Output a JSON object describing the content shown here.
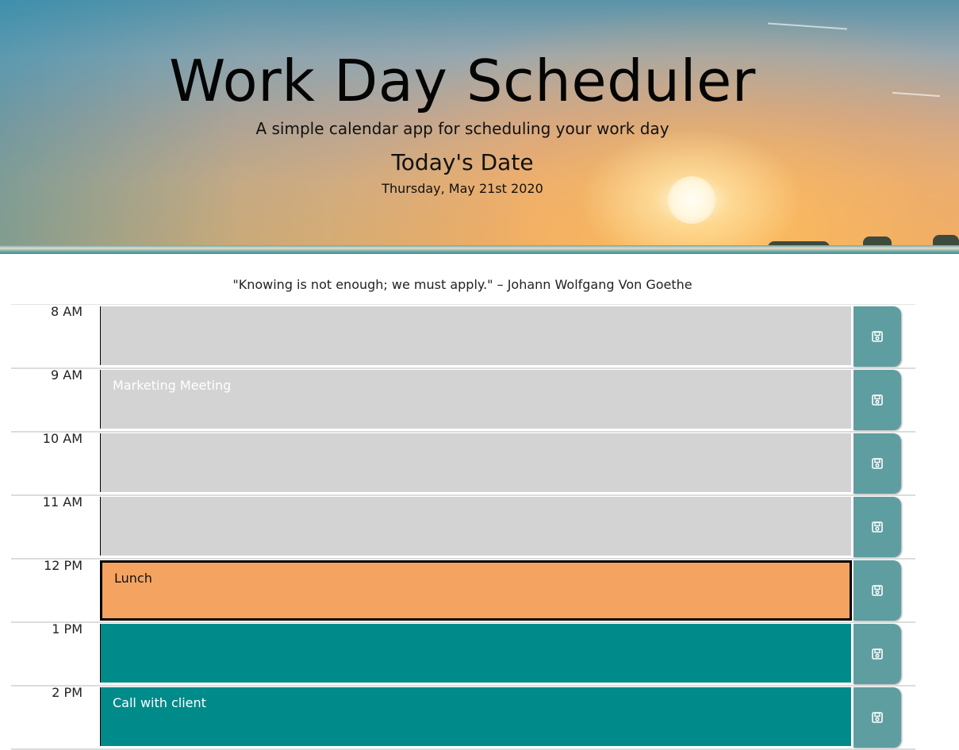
{
  "header": {
    "title": "Work Day Scheduler",
    "subtitle": "A simple calendar app for scheduling your work day",
    "date_heading": "Today's Date",
    "date_value": "Thursday, May 21st 2020"
  },
  "quote": "\"Knowing is not enough; we must apply.\" – Johann Wolfgang Von Goethe",
  "colors": {
    "past": "#d3d3d3",
    "present": "#f4a460",
    "future": "#008b8b",
    "save_button": "#5f9ea0"
  },
  "schedule": [
    {
      "hour": "8 AM",
      "text": "",
      "state": "past"
    },
    {
      "hour": "9 AM",
      "text": "Marketing Meeting",
      "state": "past"
    },
    {
      "hour": "10 AM",
      "text": "",
      "state": "past"
    },
    {
      "hour": "11 AM",
      "text": "",
      "state": "past"
    },
    {
      "hour": "12 PM",
      "text": "Lunch",
      "state": "present"
    },
    {
      "hour": "1 PM",
      "text": "",
      "state": "future"
    },
    {
      "hour": "2 PM",
      "text": "Call with client",
      "state": "future"
    }
  ],
  "icons": {
    "save": "floppy-disk-icon"
  }
}
